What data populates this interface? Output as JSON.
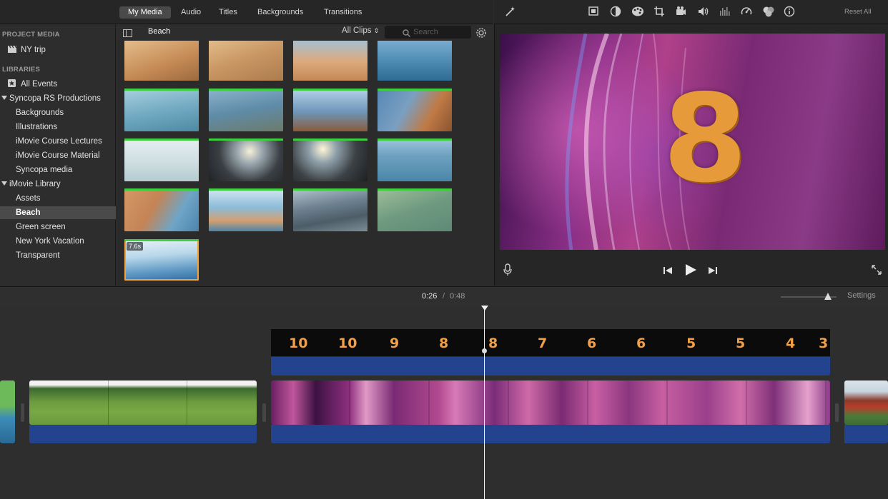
{
  "tabs": [
    "My Media",
    "Audio",
    "Titles",
    "Backgrounds",
    "Transitions"
  ],
  "sidebar": {
    "project_media_heading": "PROJECT MEDIA",
    "project_item": "NY trip",
    "libraries_heading": "LIBRARIES",
    "items": [
      "All Events",
      "Syncopa RS Productions",
      "Backgrounds",
      "Illustrations",
      "iMovie Course Lectures",
      "iMovie Course Material",
      "Syncopa media",
      "iMovie Library",
      "Assets",
      "Beach",
      "Green screen",
      "New York Vacation",
      "Transparent"
    ],
    "selected": "Beach"
  },
  "browser": {
    "event_title": "Beach",
    "filter": "All Clips",
    "search_placeholder": "Search",
    "selected_clip_duration": "7.6s"
  },
  "viewer": {
    "reset_label": "Reset All",
    "overlay_number": "8"
  },
  "timeline": {
    "current_time": "0:26",
    "separator": "/",
    "total_time": "0:48",
    "settings_label": "Settings",
    "zoom_level": 0.85,
    "title_numbers": [
      "10",
      "10",
      "9",
      "8",
      "8",
      "7",
      "6",
      "6",
      "5",
      "5",
      "4",
      "3"
    ]
  },
  "colors": {
    "accent_green": "#3fce3f",
    "audio_blue": "#23438f",
    "countdown_orange": "#f0a048"
  }
}
